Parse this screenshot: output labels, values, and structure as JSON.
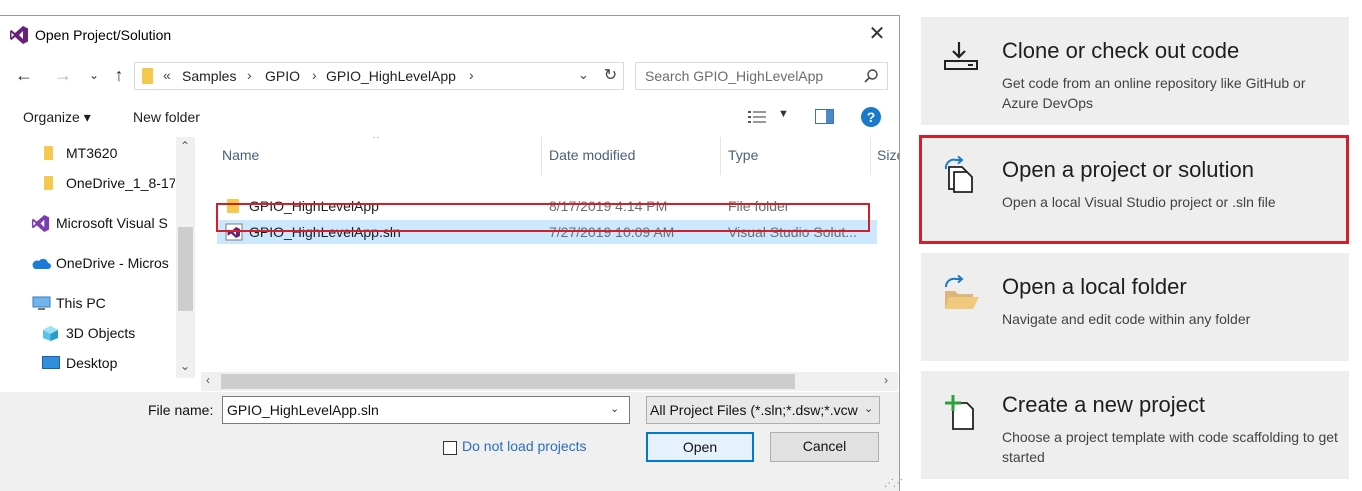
{
  "dialog": {
    "title": "Open Project/Solution",
    "address": {
      "overflow": "«",
      "crumbs": [
        "Samples",
        "GPIO",
        "GPIO_HighLevelApp"
      ]
    },
    "search_placeholder": "Search GPIO_HighLevelApp",
    "toolbar": {
      "organize_label": "Organize ▾",
      "new_folder_label": "New folder"
    },
    "nav_items": [
      {
        "label": "MT3620",
        "icon": "folder-icon"
      },
      {
        "label": "OneDrive_1_8-17",
        "icon": "folder-icon"
      },
      {
        "label": "Microsoft Visual S",
        "icon": "visual-studio-icon"
      },
      {
        "label": "OneDrive - Micros",
        "icon": "onedrive-cloud-icon"
      },
      {
        "label": "This PC",
        "icon": "pc-icon"
      },
      {
        "label": "3D Objects",
        "icon": "3d-objects-icon"
      },
      {
        "label": "Desktop",
        "icon": "desktop-icon"
      }
    ],
    "columns": [
      "Name",
      "Date modified",
      "Type",
      "Size"
    ],
    "files": [
      {
        "name": "GPIO_HighLevelApp",
        "date": "8/17/2019 4:14 PM",
        "type": "File folder",
        "icon": "folder-icon",
        "selected": false
      },
      {
        "name": "GPIO_HighLevelApp.sln",
        "date": "7/27/2019 10:09 AM",
        "type": "Visual Studio Solut...",
        "icon": "solution-file-icon",
        "selected": true
      }
    ],
    "file_name_label": "File name:",
    "file_name_value": "GPIO_HighLevelApp.sln",
    "filter_value": "All Project Files (*.sln;*.dsw;*.vcw",
    "do_not_load_label": "Do not load projects",
    "open_label": "Open",
    "cancel_label": "Cancel"
  },
  "start_panel": {
    "cards": [
      {
        "title": "Clone or check out code",
        "desc": "Get code from an online repository like GitHub or Azure DevOps",
        "icon": "clone-download-icon",
        "highlighted": false
      },
      {
        "title": "Open a project or solution",
        "desc": "Open a local Visual Studio project or .sln file",
        "icon": "open-project-icon",
        "highlighted": true
      },
      {
        "title": "Open a local folder",
        "desc": "Navigate and edit code within any folder",
        "icon": "open-folder-icon",
        "highlighted": false
      },
      {
        "title": "Create a new project",
        "desc": "Choose a project template with code scaffolding to get started",
        "icon": "new-project-icon",
        "highlighted": false
      }
    ]
  },
  "colors": {
    "highlight_red": "#d0202b",
    "selection_blue": "#cce8ff",
    "card_bg": "#efeeee",
    "link_blue": "#2a6ebd",
    "vs_purple": "#68217a"
  }
}
